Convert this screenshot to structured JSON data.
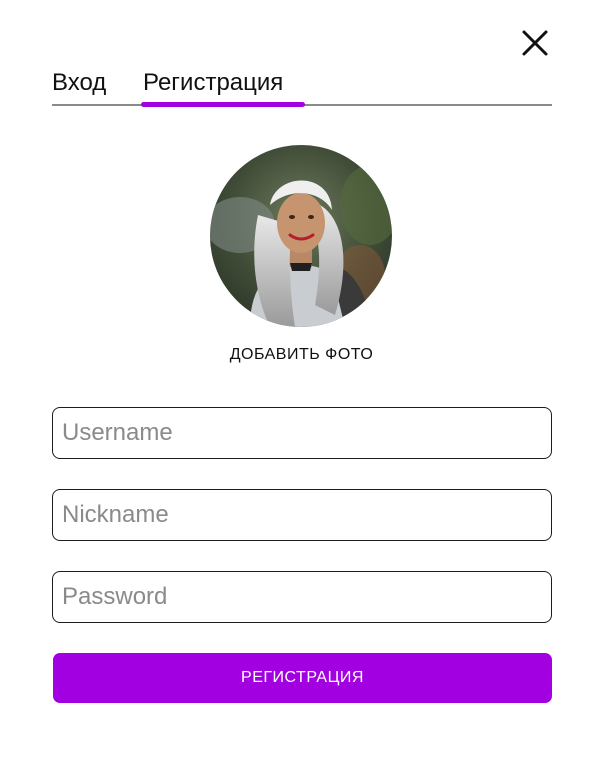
{
  "colors": {
    "accent": "#a200e0",
    "tab_line": "#8a8a8a",
    "placeholder": "#8a8a8a",
    "button_text": "#ffffff"
  },
  "icons": {
    "close": "close-icon"
  },
  "tabs": [
    {
      "label": "Вход",
      "active": false
    },
    {
      "label": "Регистрация",
      "active": true
    }
  ],
  "avatar": {
    "alt": "profile-photo"
  },
  "add_photo_label": "ДОБАВИТЬ ФОТО",
  "form": {
    "username_placeholder": "Username",
    "nickname_placeholder": "Nickname",
    "password_placeholder": "Password",
    "username_value": "",
    "nickname_value": "",
    "password_value": "",
    "submit_label": "РЕГИСТРАЦИЯ"
  }
}
